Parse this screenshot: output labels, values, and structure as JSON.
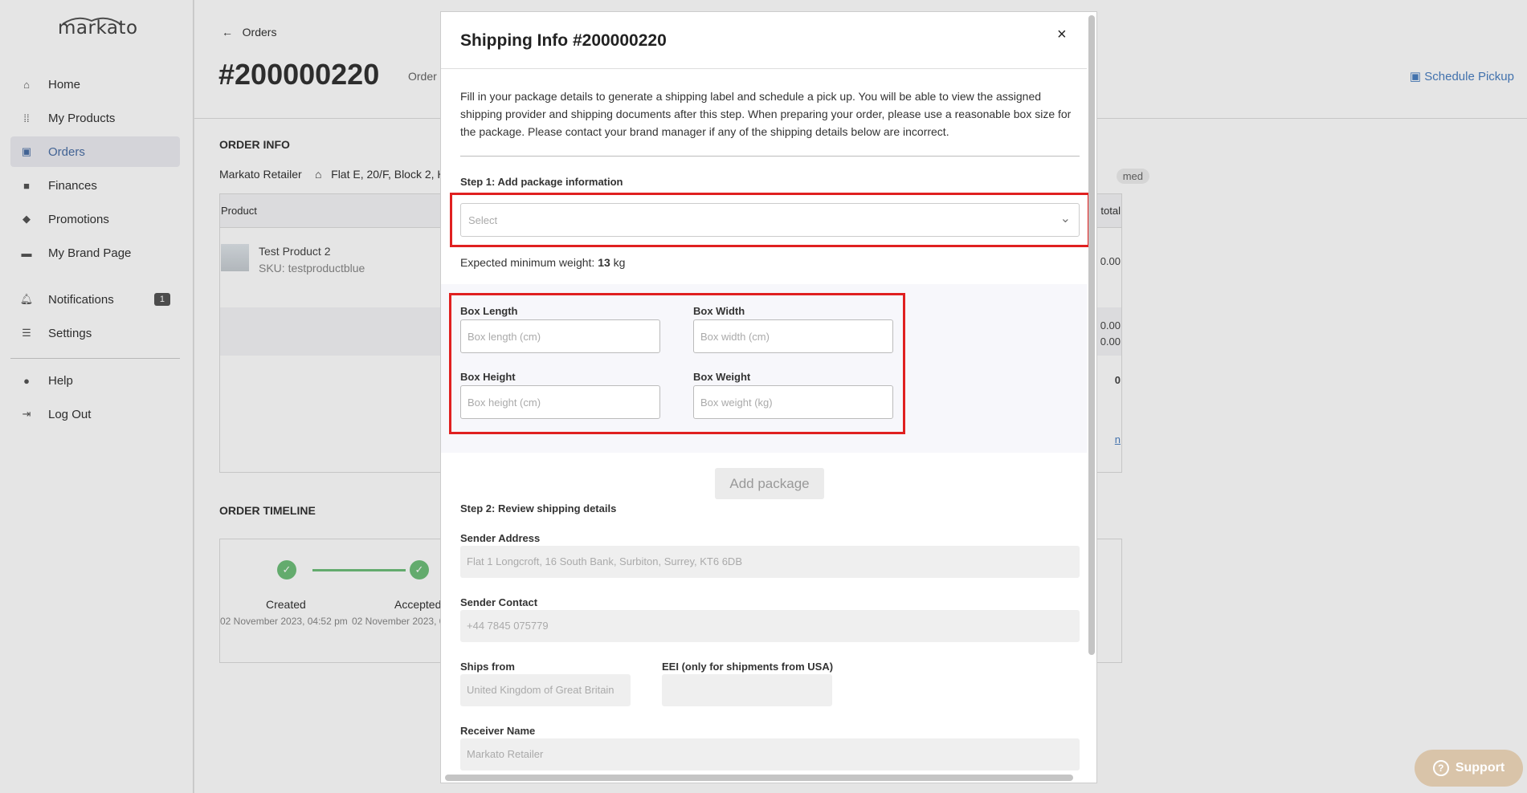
{
  "sidebar": {
    "logo": "markato",
    "items": [
      {
        "label": "Home",
        "icon": "home-icon"
      },
      {
        "label": "My Products",
        "icon": "grid-icon"
      },
      {
        "label": "Orders",
        "icon": "wallet-icon"
      },
      {
        "label": "Finances",
        "icon": "bag-icon"
      },
      {
        "label": "Promotions",
        "icon": "tag-icon"
      },
      {
        "label": "My Brand Page",
        "icon": "monitor-icon"
      },
      {
        "label": "Notifications",
        "icon": "bell-icon",
        "badge": "1"
      },
      {
        "label": "Settings",
        "icon": "sliders-icon"
      },
      {
        "label": "Help",
        "icon": "help-icon"
      },
      {
        "label": "Log Out",
        "icon": "logout-icon"
      }
    ]
  },
  "header": {
    "back_label": "Orders",
    "order_id": "#200000220",
    "order_date_fragment": "Order",
    "schedule_pickup": "Schedule Pickup"
  },
  "order_info": {
    "title": "ORDER INFO",
    "retailer": "Markato Retailer",
    "address_fragment": "Flat E, 20/F, Block 2, H",
    "status_fragment": "med",
    "table": {
      "col_product": "Product",
      "col_total": "total",
      "product_name": "Test Product 2",
      "product_sku": "SKU: testproductblue",
      "values": [
        "0.00",
        "0.00",
        "0.00",
        "0",
        "n"
      ]
    }
  },
  "timeline": {
    "title": "ORDER TIMELINE",
    "steps": [
      {
        "label": "Created",
        "date": "02 November 2023, 04:52 pm"
      },
      {
        "label": "Accepted",
        "date": "02 November 2023, 0 pm"
      }
    ]
  },
  "modal": {
    "title": "Shipping Info #200000220",
    "close": "×",
    "intro": "Fill in your package details to generate a shipping label and schedule a pick up. You will be able to view the assigned shipping provider and shipping documents after this step. When preparing your order, please use a reasonable box size for the package. Please contact your brand manager if any of the shipping details below are incorrect.",
    "step1": "Step 1: Add package information",
    "package_select_placeholder": "Select",
    "min_weight_label": "Expected minimum weight:",
    "min_weight_value": "13",
    "min_weight_unit": "kg",
    "dimensions": {
      "length_label": "Box Length",
      "length_placeholder": "Box length (cm)",
      "width_label": "Box Width",
      "width_placeholder": "Box width (cm)",
      "height_label": "Box Height",
      "height_placeholder": "Box height (cm)",
      "weight_label": "Box Weight",
      "weight_placeholder": "Box weight (kg)"
    },
    "add_package": "Add package",
    "step2": "Step 2: Review shipping details",
    "sender_address_label": "Sender Address",
    "sender_address": "Flat 1 Longcroft, 16 South Bank, Surbiton, Surrey, KT6 6DB",
    "sender_contact_label": "Sender Contact",
    "sender_contact": "+44 7845 075779",
    "ships_from_label": "Ships from",
    "ships_from": "United Kingdom of Great Britain",
    "eei_label": "EEI (only for shipments from USA)",
    "eei_value": "",
    "receiver_name_label": "Receiver Name",
    "receiver_name": "Markato Retailer"
  },
  "support": {
    "label": "Support"
  },
  "colors": {
    "highlight": "#e02020",
    "accent": "#4a7fc1",
    "success": "#6fbf7a"
  }
}
